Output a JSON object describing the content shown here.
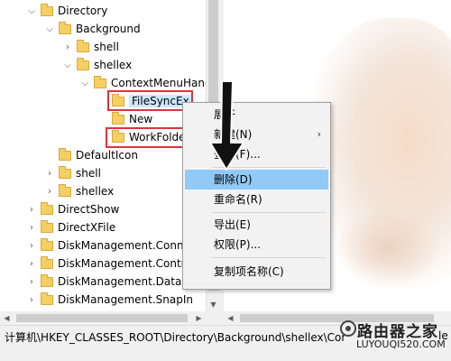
{
  "tree": {
    "items": [
      {
        "label": "Directory",
        "expander": "⌵"
      },
      {
        "label": "Background",
        "expander": "⌵"
      },
      {
        "label": "shell",
        "expander": "›"
      },
      {
        "label": "shellex",
        "expander": "⌵"
      },
      {
        "label": "ContextMenuHandlers",
        "expander": "⌵"
      },
      {
        "label": "FileSyncEx",
        "expander": ""
      },
      {
        "label": "New",
        "expander": ""
      },
      {
        "label": "WorkFolders",
        "expander": ""
      },
      {
        "label": "DefaultIcon",
        "expander": ""
      },
      {
        "label": "shell",
        "expander": "›"
      },
      {
        "label": "shellex",
        "expander": "›"
      },
      {
        "label": "DirectShow",
        "expander": "›"
      },
      {
        "label": "DirectXFile",
        "expander": "›"
      },
      {
        "label": "DiskManagement.Connection",
        "expander": "›"
      },
      {
        "label": "DiskManagement.Control",
        "expander": "›"
      },
      {
        "label": "DiskManagement.DataObject",
        "expander": "›"
      },
      {
        "label": "DiskManagement.SnapIn",
        "expander": "›"
      }
    ]
  },
  "context_menu": {
    "items": [
      {
        "label": "展开"
      },
      {
        "label": "新建(N)",
        "chevron": "›"
      },
      {
        "label": "查找(F)..."
      },
      {
        "label": "删除(D)"
      },
      {
        "label": "重命名(R)"
      },
      {
        "label": "导出(E)"
      },
      {
        "label": "权限(P)..."
      },
      {
        "label": "复制项名称(C)"
      }
    ]
  },
  "status_bar": {
    "path": "计算机\\HKEY_CLASSES_ROOT\\Directory\\Background\\shellex\\ContextMenuHandlers\\FileSyncEx",
    "suffix": "le"
  },
  "watermark": {
    "title": "路由器之家",
    "url": "LUYOUQI520.COM"
  },
  "colors": {
    "selection": "#cce8ff",
    "menu_highlight": "#91c9f7",
    "annotation_red": "#e0323a",
    "folder": "#f6cf62"
  },
  "icons": {
    "folder": "folder-icon",
    "expander": "chevron-icon",
    "cursor": "arrow-cursor-icon"
  }
}
